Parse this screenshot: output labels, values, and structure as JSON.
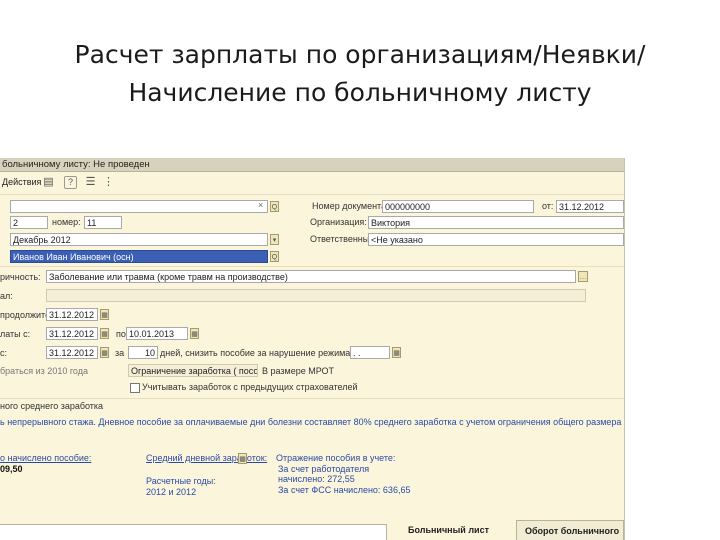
{
  "slide": {
    "title_line1": "Расчет зарплаты по организациям/Неявки/",
    "title_line2": "Начисление по больничному листу"
  },
  "window": {
    "title": "больничному листу: Не проведен"
  },
  "toolbar": {
    "actions_label": "Действия",
    "icons": [
      "save-icon",
      "print-icon",
      "help-icon",
      "list-icon",
      "structure-icon"
    ]
  },
  "header_fields": {
    "number_label": "Номер документа:",
    "number_value": "000000000",
    "date_label": "от:",
    "date_value": "31.12.2012",
    "org_label": "Организация:",
    "org_value": "Виктория",
    "responsible_label": "Ответственный:",
    "responsible_value": "<Не указано",
    "search_field": "",
    "sick_num_left": "2",
    "sick_num_label": "номер:",
    "sick_num_value": "11",
    "month_value": "Декабрь 2012",
    "employee_value": "Иванов Иван Иванович (осн)"
  },
  "body": {
    "reason_label": "ричность:",
    "reason_value": "Заболевание или травма (кроме травм на производстве)",
    "row2_label": "ал:",
    "period_label": "продолжительность:",
    "period_date": "31.12.2012",
    "pay_from_label": "латы с:",
    "pay_from_date": "31.12.2012",
    "pay_to_label": "по:",
    "pay_to_date": "10.01.2013",
    "limit_label": "с:",
    "limit_date": "31.12.2012",
    "limit_for": "за",
    "limit_days": "10",
    "limit_text": "дней, снизить пособие за нарушение режима с:",
    "limit_date2": ".  .",
    "basis_label": "браться из 2010 года",
    "basis_select": "Ограничение заработка ( пособие )",
    "basis_select2": "В размере МРОТ",
    "checkbox_label": "Учитывать заработок с предыдущих страхователей",
    "avg_earnings_title": "ного среднего заработка",
    "info_text": "ь непрерывного стажа. Дневное пособие за оплачиваемые дни болезни составляет 80% среднего заработка с учетом ограничения общего размера пособия.",
    "accrued_label": "о начислено пособие:",
    "accrued_value": "09,50",
    "avg_earnings_label": "Средний дневной заработок:",
    "calc_years_label": "Расчетные годы:",
    "calc_years_value": "2012 и 2012",
    "reflect_title": "Отражение пособия в учете:",
    "reflect_line1": "За счет работодателя",
    "reflect_line2": "начислено: 272,55",
    "reflect_line3": "За счет ФСС начислено: 636,65"
  },
  "tabs": {
    "sick_list": "Больничный лист",
    "turnover": "Оборот больничного"
  }
}
